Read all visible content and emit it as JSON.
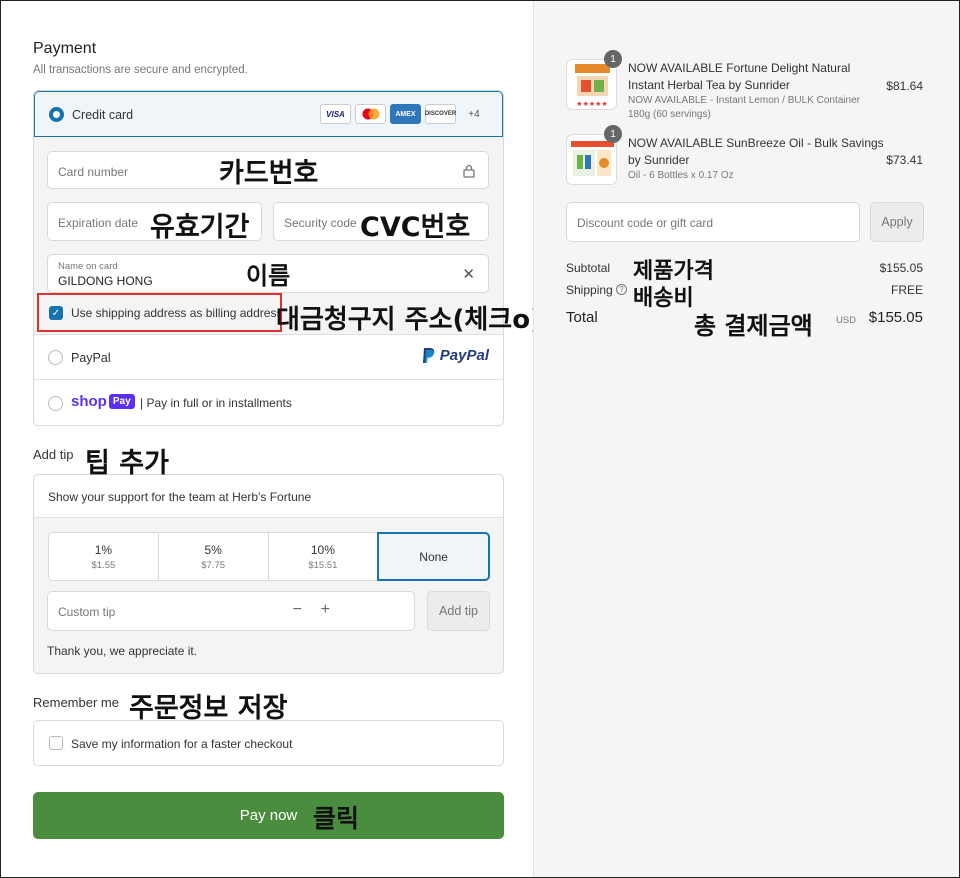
{
  "payment": {
    "title": "Payment",
    "subtitle": "All transactions are secure and encrypted.",
    "credit_card_label": "Credit card",
    "card_brands": [
      "VISA",
      "MC",
      "AMEX",
      "DISCOVER"
    ],
    "more_cards": "+4",
    "card_number_placeholder": "Card number",
    "expiration_placeholder": "Expiration date",
    "security_placeholder": "Security code",
    "name_label": "Name on card",
    "name_value": "GILDONG HONG",
    "billing_checkbox_label": "Use shipping address as billing address",
    "billing_checked": true,
    "paypal_label": "PayPal",
    "paypal_logo": "PayPal",
    "shop_logo": "shop",
    "shop_pay_badge": "Pay",
    "shop_pay_label": "| Pay in full or in installments"
  },
  "tip": {
    "title": "Add tip",
    "support_text": "Show your support for the team at Herb's Fortune",
    "options": [
      {
        "pct": "1%",
        "amount": "$1.55"
      },
      {
        "pct": "5%",
        "amount": "$7.75"
      },
      {
        "pct": "10%",
        "amount": "$15.51"
      }
    ],
    "none_label": "None",
    "custom_placeholder": "Custom tip",
    "minus": "−",
    "plus": "+",
    "add_button": "Add tip",
    "thanks": "Thank you, we appreciate it."
  },
  "remember": {
    "title": "Remember me",
    "checkbox_label": "Save my information for a faster checkout",
    "checked": false
  },
  "pay_button": "Pay now",
  "annotations": {
    "card_number": "카드번호",
    "expiration": "유효기간",
    "cvc": "CVC번호",
    "name": "이름",
    "billing": "대금청구지 주소(체크o)",
    "tip": "팁 추가",
    "remember": "주문정보 저장",
    "click": "클릭",
    "product_price": "제품가격",
    "shipping": "배송비",
    "total": "총 결제금액"
  },
  "cart": {
    "items": [
      {
        "qty": "1",
        "name_line1": "NOW AVAILABLE Fortune Delight Natural",
        "name_line2": "Instant Herbal Tea by Sunrider",
        "variant_line1": "NOW AVAILABLE - Instant Lemon / BULK Container",
        "variant_line2": "180g (60 servings)",
        "price": "$81.64"
      },
      {
        "qty": "1",
        "name_line1": "NOW AVAILABLE SunBreeze Oil - Bulk Savings",
        "name_line2": "by Sunrider",
        "variant_line1": "Oil - 6 Bottles x 0.17 Oz",
        "price": "$73.41"
      }
    ],
    "discount_placeholder": "Discount code or gift card",
    "apply_button": "Apply",
    "subtotal_label": "Subtotal",
    "subtotal_value": "$155.05",
    "shipping_label": "Shipping",
    "shipping_value": "FREE",
    "total_label": "Total",
    "currency": "USD",
    "total_value": "$155.05"
  }
}
